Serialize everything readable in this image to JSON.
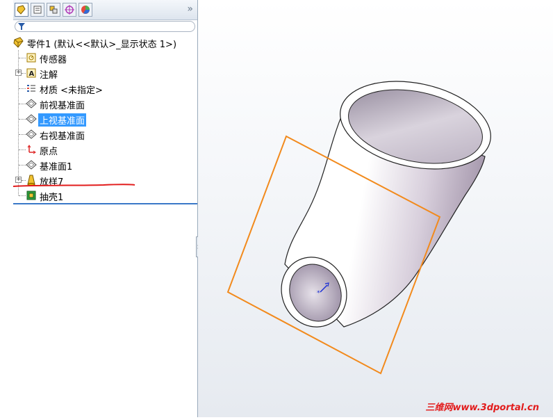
{
  "tree": {
    "root": {
      "label": "零件1 (默认<<默认>_显示状态 1>)"
    },
    "items": [
      {
        "label": "传感器",
        "icon": "sensor-icon",
        "expandable": false,
        "selected": false
      },
      {
        "label": "注解",
        "icon": "annotation-icon",
        "expandable": true,
        "selected": false
      },
      {
        "label": "材质 <未指定>",
        "icon": "material-icon",
        "expandable": false,
        "selected": false
      },
      {
        "label": "前视基准面",
        "icon": "plane-icon",
        "expandable": false,
        "selected": false
      },
      {
        "label": "上视基准面",
        "icon": "plane-icon",
        "expandable": false,
        "selected": true
      },
      {
        "label": "右视基准面",
        "icon": "plane-icon",
        "expandable": false,
        "selected": false
      },
      {
        "label": "原点",
        "icon": "origin-icon",
        "expandable": false,
        "selected": false
      },
      {
        "label": "基准面1",
        "icon": "plane-icon",
        "expandable": false,
        "selected": false
      },
      {
        "label": "放样7",
        "icon": "loft-icon",
        "expandable": true,
        "selected": false
      },
      {
        "label": "抽壳1",
        "icon": "shell-icon",
        "expandable": false,
        "selected": false
      }
    ]
  },
  "tabs": [
    "featuremanager-tab",
    "propertymanager-tab",
    "configurationmanager-tab",
    "dimxpert-tab",
    "display-manager-tab"
  ],
  "more_label": "»",
  "watermark": "三维网www.3dportal.cn",
  "colors": {
    "selection": "#3399ff",
    "plane_outline": "#f28a1c",
    "annotation_stroke": "#e21c1c"
  }
}
